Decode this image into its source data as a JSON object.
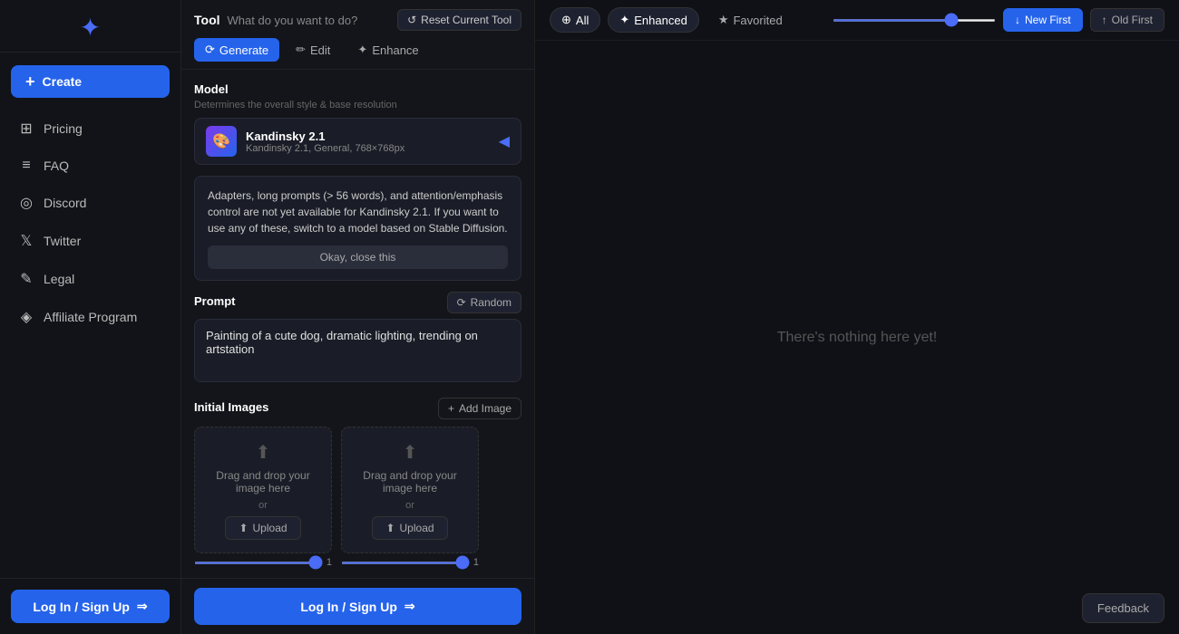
{
  "sidebar": {
    "logo_icon": "✦",
    "create_label": "Create",
    "nav_items": [
      {
        "id": "pricing",
        "label": "Pricing",
        "icon": "⊞"
      },
      {
        "id": "faq",
        "label": "FAQ",
        "icon": "≡"
      },
      {
        "id": "discord",
        "label": "Discord",
        "icon": "◎"
      },
      {
        "id": "twitter",
        "label": "Twitter",
        "icon": "𝕏"
      },
      {
        "id": "legal",
        "label": "Legal",
        "icon": "✎"
      },
      {
        "id": "affiliate",
        "label": "Affiliate Program",
        "icon": "◈"
      }
    ],
    "login_label": "Log In / Sign Up",
    "login_arrow": "→"
  },
  "tool": {
    "label": "Tool",
    "question": "What do you want to do?",
    "reset_label": "Reset Current Tool",
    "tabs": [
      {
        "id": "generate",
        "label": "Generate",
        "icon": "⟳",
        "active": true
      },
      {
        "id": "edit",
        "label": "Edit",
        "icon": "✏",
        "active": false
      },
      {
        "id": "enhance",
        "label": "Enhance",
        "icon": "✦",
        "active": false
      }
    ]
  },
  "model": {
    "section_label": "Model",
    "section_sublabel": "Determines the overall style & base resolution",
    "name": "Kandinsky 2.1",
    "description": "Kandinsky 2.1, General, 768×768px",
    "avatar_icon": "🎨"
  },
  "warning": {
    "text": "Adapters, long prompts (> 56 words), and attention/emphasis control are not yet available for Kandinsky 2.1. If you want to use any of these, switch to a model based on Stable Diffusion.",
    "close_label": "Okay, close this"
  },
  "prompt": {
    "label": "Prompt",
    "random_label": "Random",
    "value": "Painting of a cute dog, dramatic lighting, trending on artstation",
    "placeholder": "Painting of a cute dog, dramatic lighting, trending on artstation"
  },
  "initial_images": {
    "label": "Initial Images",
    "add_label": "Add Image",
    "slots": [
      {
        "id": "slot1",
        "drag_text": "Drag and drop your image here",
        "or_text": "or",
        "upload_label": "Upload",
        "strength": 1.0
      },
      {
        "id": "slot2",
        "drag_text": "Drag and drop your image here",
        "or_text": "or",
        "upload_label": "Upload",
        "strength": 1.0
      }
    ]
  },
  "main_login": {
    "label": "Log In / Sign Up",
    "arrow": "→"
  },
  "filter_bar": {
    "chips": [
      {
        "id": "all",
        "label": "All",
        "icon": "⊕",
        "active": true
      },
      {
        "id": "enhanced",
        "label": "Enhanced",
        "icon": "✦",
        "active": true
      },
      {
        "id": "favorited",
        "label": "Favorited",
        "icon": "★",
        "active": false
      }
    ],
    "sort_buttons": [
      {
        "id": "new_first",
        "label": "New First",
        "icon": "↓",
        "active": true
      },
      {
        "id": "old_first",
        "label": "Old First",
        "icon": "↑",
        "active": false
      }
    ]
  },
  "empty_state": {
    "text": "There's nothing here yet!"
  },
  "feedback": {
    "label": "Feedback"
  }
}
